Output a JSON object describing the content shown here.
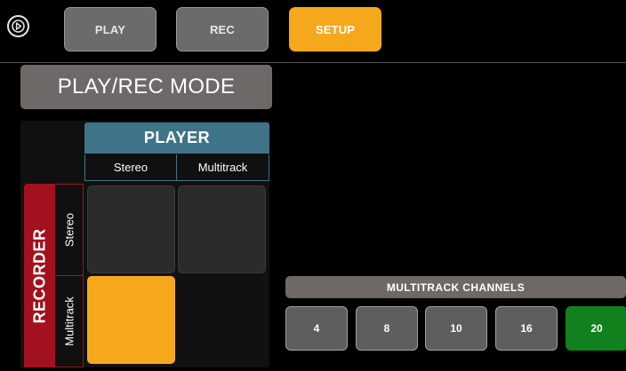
{
  "tabs": [
    {
      "label": "PLAY",
      "active": false
    },
    {
      "label": "REC",
      "active": false
    },
    {
      "label": "SETUP",
      "active": true
    }
  ],
  "mode_title": "PLAY/REC MODE",
  "player": {
    "title": "PLAYER",
    "columns": [
      "Stereo",
      "Multitrack"
    ]
  },
  "recorder": {
    "title": "RECORDER",
    "rows": [
      "Stereo",
      "Multitrack"
    ]
  },
  "matrix_selected": {
    "recorder": "Multitrack",
    "player": "Stereo"
  },
  "multitrack_channels": {
    "title": "MULTITRACK CHANNELS",
    "options": [
      "4",
      "8",
      "10",
      "16",
      "20"
    ],
    "selected": "20"
  },
  "colors": {
    "accent_orange": "#f6a81c",
    "player_blue": "#3f7488",
    "recorder_red": "#a1121e",
    "selected_green": "#11801d"
  }
}
